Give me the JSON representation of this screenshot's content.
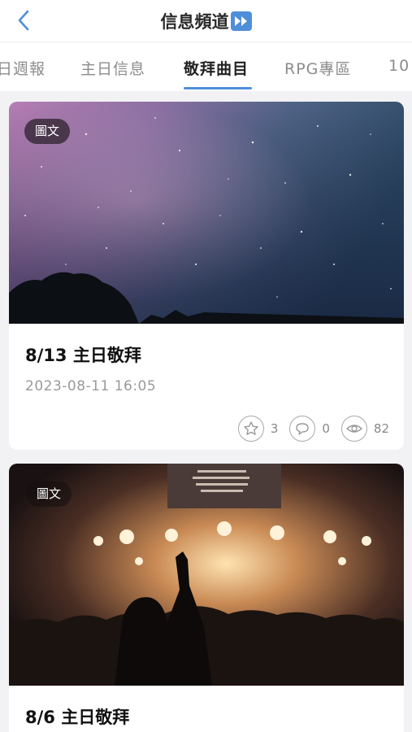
{
  "header": {
    "title": "信息頻道",
    "back_icon": "chevron-left-icon",
    "title_icon": "fast-forward-icon",
    "accent": "#4f8fda"
  },
  "tabs": [
    {
      "label": "日週報"
    },
    {
      "label": "主日信息"
    },
    {
      "label": "敬拜曲目",
      "active": true
    },
    {
      "label": "RPG專區"
    },
    {
      "label": "10"
    }
  ],
  "posts": [
    {
      "badge": "圖文",
      "title": "8/13 主日敬拜",
      "date": "2023-08-11 16:05",
      "likes": "3",
      "comments": "0",
      "views": "82",
      "image": "starry-sky"
    },
    {
      "badge": "圖文",
      "title": "8/6 主日敬拜",
      "image": "worship-concert"
    }
  ]
}
